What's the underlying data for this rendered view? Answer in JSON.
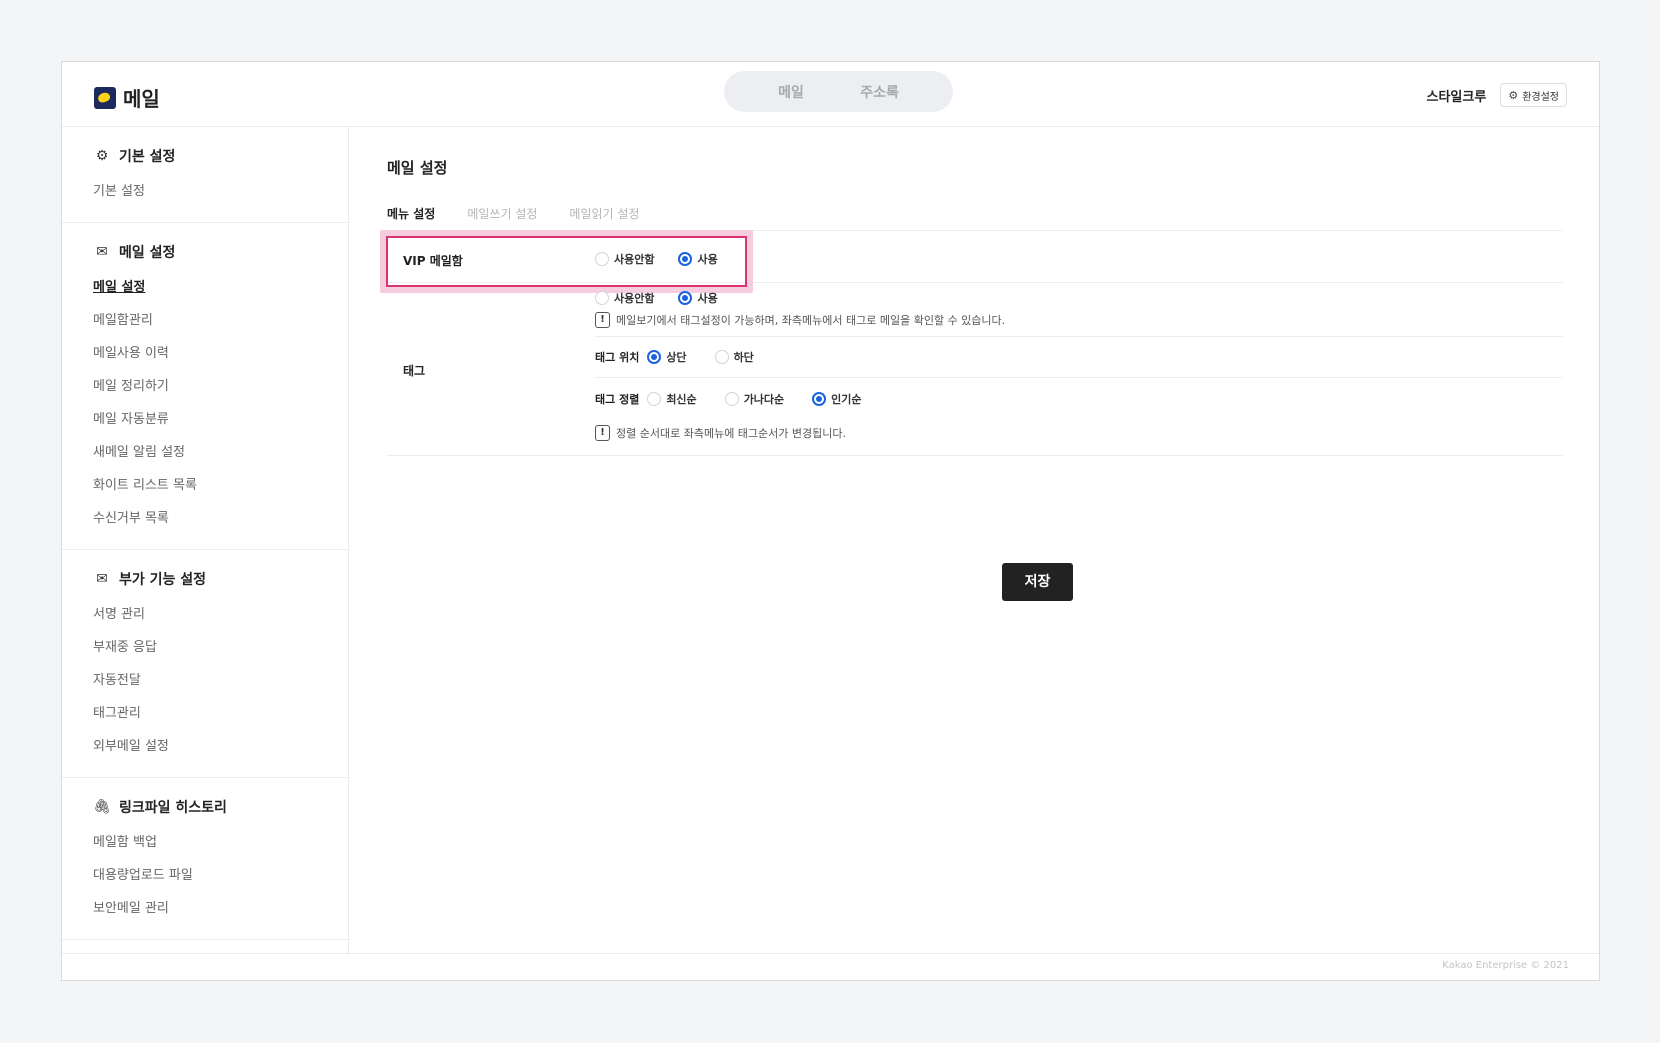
{
  "app": {
    "title": "메일"
  },
  "nav_tabs": [
    "메일",
    "주소록"
  ],
  "user": {
    "name": "스타일크루",
    "settings_label": "환경설정"
  },
  "sidebar": {
    "sections": [
      {
        "title": "기본 설정",
        "icon": "gear-icon",
        "items": [
          "기본 설정"
        ]
      },
      {
        "title": "메일 설정",
        "icon": "mail-settings-icon",
        "items": [
          "메일 설정",
          "메일함관리",
          "메일사용 이력",
          "메일 정리하기",
          "메일 자동분류",
          "새메일 알림 설정",
          "화이트 리스트 목록",
          "수신거부 목록"
        ],
        "active_item": "메일 설정"
      },
      {
        "title": "부가 기능 설정",
        "icon": "mail-plus-icon",
        "items": [
          "서명 관리",
          "부재중 응답",
          "자동전달",
          "태그관리",
          "외부메일 설정"
        ]
      },
      {
        "title": "링크파일 히스토리",
        "icon": "paperclip-icon",
        "items": [
          "메일함 백업",
          "대용량업로드 파일",
          "보안메일 관리"
        ]
      }
    ]
  },
  "main": {
    "title": "메일 설정",
    "tabs": [
      "메뉴 설정",
      "메일쓰기 설정",
      "메일읽기 설정"
    ],
    "active_tab": "메뉴 설정",
    "vip": {
      "label": "VIP 메일함",
      "options": [
        "사용안함",
        "사용"
      ],
      "selected": "사용"
    },
    "tag": {
      "label": "태그",
      "use_options": [
        "사용안함",
        "사용"
      ],
      "use_selected": "사용",
      "use_notice": "메일보기에서 태그설정이 가능하며, 좌측메뉴에서 태그로 메일을 확인할 수 있습니다.",
      "position_label": "태그 위치",
      "position_options": [
        "상단",
        "하단"
      ],
      "position_selected": "상단",
      "sort_label": "태그 정렬",
      "sort_options": [
        "최신순",
        "가나다순",
        "인기순"
      ],
      "sort_selected": "인기순",
      "sort_notice": "정렬 순서대로 좌측메뉴에 태그순서가 변경됩니다."
    },
    "save_label": "저장"
  },
  "footer": {
    "copyright": "Kakao Enterprise © 2021"
  },
  "colors": {
    "accent": "#1a62e0",
    "highlight": "#d9346f",
    "button": "#222222"
  }
}
